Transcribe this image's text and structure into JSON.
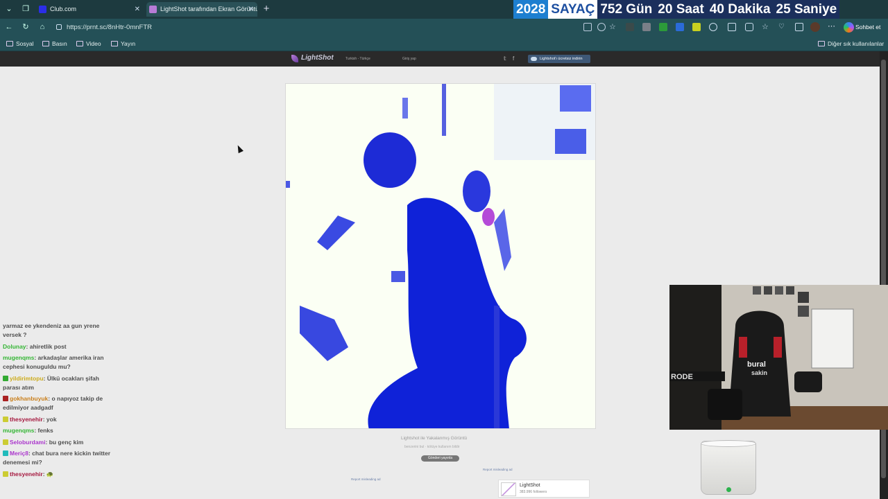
{
  "browser": {
    "tabs": [
      {
        "label": "Club.com",
        "favicon_color": "#2b2ee8",
        "active": false
      },
      {
        "label": "LightShot tarafından Ekran Görüntü",
        "favicon_color": "#b77bd6",
        "active": true
      }
    ],
    "new_tab_icon": "plus-icon",
    "address": "https://prnt.sc/8nHtr-0mnFTR",
    "chat_button": "Sohbet et",
    "bookmarks": [
      "Sosyal",
      "Basın",
      "Video",
      "Yayın"
    ],
    "other_bookmarks": "Diğer sık kullanılanlar"
  },
  "counter": {
    "year": "2028",
    "label": "SAYAÇ",
    "days": "752 Gün",
    "hours": "20 Saat",
    "minutes": "40 Dakika",
    "seconds": "25 Saniye",
    "colors": {
      "year_bg": "#1d7fd0",
      "label_bg": "#ffffff",
      "label_fg": "#1d4fa0",
      "rest_bg": "#1b2f5c"
    }
  },
  "lightshot": {
    "logo": "LightShot",
    "language": "Turkish - Türkçe",
    "login": "Giriş yap",
    "social": [
      "twitter-icon",
      "facebook-icon"
    ],
    "download": "Lightshot'ı ücretsiz indirin",
    "caption": "Lightshot ile Yakalanmış Görüntü",
    "caption_actions": "benzerini bul  ·  kötüye kullanım bildir",
    "tweet_button": "Gönderi yayınla",
    "report_left": "Report misleading ad",
    "report_right": "Report misleading ad",
    "fb_card": {
      "name": "LightShot",
      "followers": "383.996 followers"
    }
  },
  "chat": [
    {
      "user": "",
      "text": "yarmaz ee ykendeniz aa gun yrene versek ?",
      "color": "#b33"
    },
    {
      "user": "Dolunay",
      "text": "ahiretlik post",
      "color": "#2fb02f"
    },
    {
      "user": "mugenqms",
      "text": "arkadaşlar amerika iran cephesi konuguldu mu?",
      "color": "#2fb02f"
    },
    {
      "user": "yildirimtopu",
      "text": "Ülkü ocakları şifah parası atım",
      "color": "#c7a616",
      "badge": "#3a3"
    },
    {
      "user": "gokhanbuyuk",
      "text": "o napıyoz takip de edilmiyor aadgadf",
      "color": "#c47a16",
      "badge": "#a22"
    },
    {
      "user": "thesyenehir",
      "text": "yok",
      "color": "#a0143a",
      "badge": "#cc3"
    },
    {
      "user": "mugenqms",
      "text": "fenks",
      "color": "#2fb02f"
    },
    {
      "user": "Seloburdami",
      "text": "bu genç kim",
      "color": "#a531c7",
      "badge": "#cc3"
    },
    {
      "user": "Meriç8",
      "text": "chat bura nere kickin twitter denemesi mi?",
      "color": "#a531c7",
      "badge": "#2bb"
    },
    {
      "user": "thesyenehir",
      "text": "🐢",
      "color": "#a0143a",
      "badge": "#cc3"
    }
  ],
  "webcam": {
    "chair_text_1": "bural",
    "chair_text_2": "sakin",
    "mic_brand": "RODE"
  }
}
